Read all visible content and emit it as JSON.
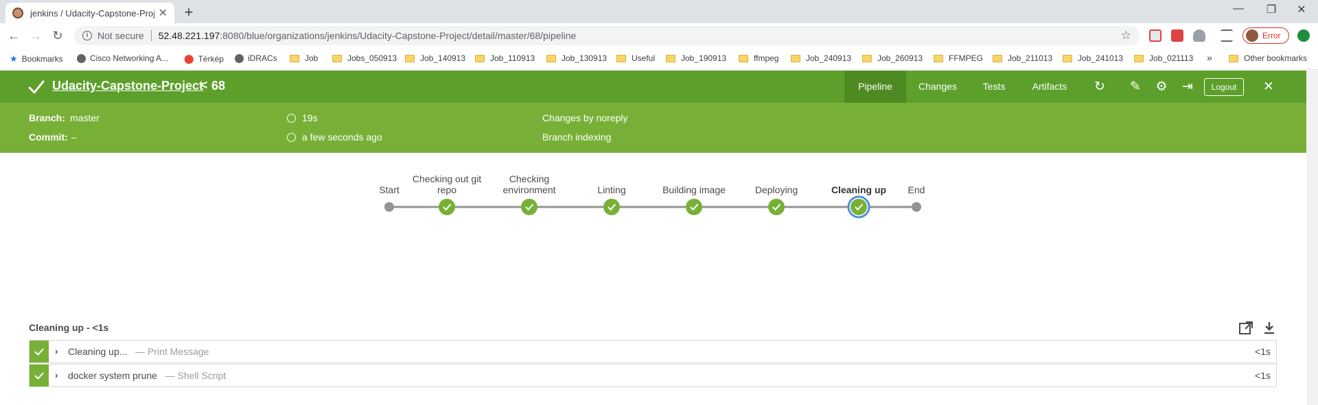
{
  "browser": {
    "tab_title": "jenkins / Udacity-Capstone-Proje",
    "url_secure_label": "Not secure",
    "url_host": "52.48.221.197",
    "url_path": ":8080/blue/organizations/jenkins/Udacity-Capstone-Project/detail/master/68/pipeline",
    "profile_error": "Error",
    "bookmarks": [
      "Bookmarks",
      "Cisco Networking A...",
      "Térkép",
      "iDRACs",
      "Job",
      "Jobs_050913",
      "Job_140913",
      "Job_110913",
      "Job_130913",
      "Useful",
      "Job_190913",
      "ffmpeg",
      "Job_240913",
      "Job_260913",
      "FFMPEG",
      "Job_211013",
      "Job_241013",
      "Job_021113"
    ],
    "bookmarks_overflow": "»",
    "other_bookmarks": "Other bookmarks"
  },
  "header": {
    "project": "Udacity-Capstone-Project",
    "chevron": "<",
    "run_number": "68",
    "tabs": [
      "Pipeline",
      "Changes",
      "Tests",
      "Artifacts"
    ],
    "active_tab": "Pipeline",
    "logout": "Logout"
  },
  "summary": {
    "branch_label": "Branch:",
    "branch": "master",
    "commit_label": "Commit:",
    "commit": "–",
    "duration": "19s",
    "time": "a few seconds ago",
    "changes": "Changes by noreply",
    "cause": "Branch indexing"
  },
  "pipeline": {
    "stages": [
      {
        "name": "Start",
        "lines": [
          "Start"
        ],
        "kind": "endpoint"
      },
      {
        "name": "Checking out git repo",
        "lines": [
          "Checking out git",
          "repo"
        ],
        "kind": "success"
      },
      {
        "name": "Checking environment",
        "lines": [
          "Checking",
          "environment"
        ],
        "kind": "success"
      },
      {
        "name": "Linting",
        "lines": [
          "Linting"
        ],
        "kind": "success"
      },
      {
        "name": "Building image",
        "lines": [
          "Building image"
        ],
        "kind": "success"
      },
      {
        "name": "Deploying",
        "lines": [
          "Deploying"
        ],
        "kind": "success"
      },
      {
        "name": "Cleaning up",
        "lines": [
          "Cleaning up"
        ],
        "kind": "success",
        "selected": true
      },
      {
        "name": "End",
        "lines": [
          "End"
        ],
        "kind": "endpoint"
      }
    ],
    "colors": {
      "success": "#78b037",
      "endpoint": "#949393",
      "selected_ring": "#4a90e2",
      "connector": "#949393"
    }
  },
  "steps": {
    "title": "Cleaning up - <1s",
    "rows": [
      {
        "name": "Cleaning up...",
        "type": "— Print Message",
        "duration": "<1s"
      },
      {
        "name": "docker system prune",
        "type": "— Shell Script",
        "duration": "<1s"
      }
    ]
  }
}
